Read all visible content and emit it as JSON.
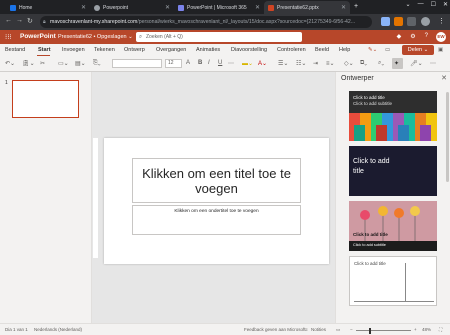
{
  "browser": {
    "tabs": [
      {
        "title": "Home",
        "icon_color": "#1a73e8"
      },
      {
        "title": "Powerpoint",
        "icon_color": "#9aa0a6"
      },
      {
        "title": "PowerPoint | Microsoft 365",
        "icon_color": "#7b83eb"
      },
      {
        "title": "Presentatie62.pptx",
        "icon_color": "#d04423"
      }
    ],
    "url_host": "mavoschravenlant-my.sharepoint.com",
    "url_path": "/personal/wierks_mavoschravenlant_nl/_layouts/15/doc.aspx?sourcedoc={21275349-6f56-42..."
  },
  "office": {
    "app_name": "PowerPoint",
    "doc_name": "Presentatie62 • Opgeslagen ⌄",
    "search_placeholder": "Zoeken (Alt + Q)",
    "avatar_initials": "EW",
    "share_label": "Delen ⌄",
    "accent": "#b7472a"
  },
  "ribbon": {
    "tabs": [
      "Bestand",
      "Start",
      "Invoegen",
      "Tekenen",
      "Ontwerp",
      "Overgangen",
      "Animaties",
      "Diavoorstelling",
      "Controleren",
      "Beeld",
      "Help"
    ],
    "active_tab": "Start",
    "font_size": "12"
  },
  "thumbnails": {
    "slide_number": "1"
  },
  "slide": {
    "title": "Klikken om een titel toe te voegen",
    "subtitle": "Klikken om een ondertitel toe te voegen"
  },
  "designer": {
    "title": "Ontwerper",
    "cards": [
      {
        "line1": "Click to add title",
        "line2": "Click to add subtitle",
        "bg": "#2e2e2e",
        "fg": "#ffffff"
      },
      {
        "line1": "Click to add",
        "line2": "title",
        "bg": "#1b1b2f",
        "fg": "#ffffff"
      },
      {
        "line1": "Click to add title",
        "line2": "Click to add subtitle",
        "bg": "#d9cfc9",
        "fg": "#111111"
      },
      {
        "line1": "Click to add title",
        "line2": "",
        "bg": "#ffffff",
        "fg": "#444444"
      }
    ]
  },
  "status": {
    "slide_info": "Dia 1 van 1",
    "language": "Nederlands (Nederland)",
    "feedback": "Feedback geven aan Microsoft",
    "notes": "Notities",
    "zoom": "48%"
  }
}
